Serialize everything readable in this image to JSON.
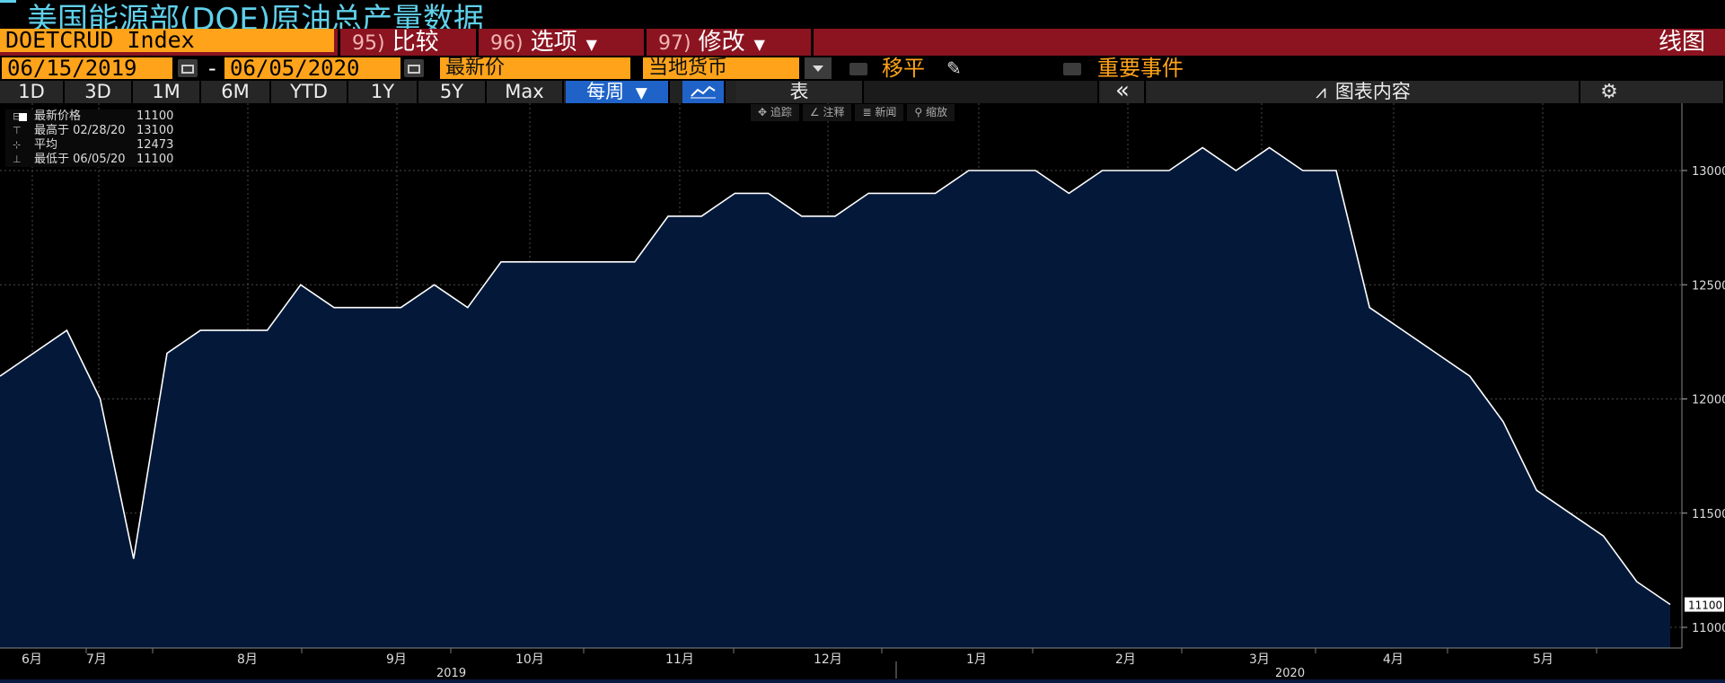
{
  "title": "美国能源部(DOE)原油总产量数据",
  "command_bar": {
    "ticker": "DOETCRUD Index",
    "compare_num": "95)",
    "compare_label": "比较",
    "options_num": "96)",
    "options_label": "选项",
    "edit_num": "97)",
    "edit_label": "修改",
    "chart_type": "线图"
  },
  "date_row": {
    "start_date": "06/15/2019",
    "dash": "-",
    "end_date": "06/05/2020",
    "price_field": "最新价",
    "currency_field": "当地货币",
    "shift_label": "移平",
    "events_label": "重要事件"
  },
  "range_bar": {
    "ranges": [
      "1D",
      "3D",
      "1M",
      "6M",
      "YTD",
      "1Y",
      "5Y",
      "Max"
    ],
    "frequency": "每周",
    "table_label": "表",
    "chart_content_label": "图表内容"
  },
  "tools": [
    "追踪",
    "注释",
    "新闻",
    "缩放"
  ],
  "legend": {
    "last_label": "最新价格",
    "last_value": "11100",
    "high_label": "最高于 02/28/20",
    "high_value": "13100",
    "avg_label": "平均",
    "avg_value": "12473",
    "low_label": "最低于 06/05/20",
    "low_value": "11100"
  },
  "colors": {
    "area_fill": "#04193a",
    "line": "#ffffff",
    "accent_orange": "#ffa31a",
    "bar_red": "#8b1420",
    "title_cyan": "#5fd0ea"
  },
  "chart_data": {
    "type": "area",
    "x": [
      "2019-06-07",
      "2019-06-14",
      "2019-06-21",
      "2019-06-28",
      "2019-07-05",
      "2019-07-12",
      "2019-07-19",
      "2019-07-26",
      "2019-08-02",
      "2019-08-09",
      "2019-08-16",
      "2019-08-23",
      "2019-08-30",
      "2019-09-06",
      "2019-09-13",
      "2019-09-20",
      "2019-09-27",
      "2019-10-04",
      "2019-10-11",
      "2019-10-18",
      "2019-10-25",
      "2019-11-01",
      "2019-11-08",
      "2019-11-15",
      "2019-11-22",
      "2019-11-29",
      "2019-12-06",
      "2019-12-13",
      "2019-12-20",
      "2019-12-27",
      "2020-01-03",
      "2020-01-10",
      "2020-01-17",
      "2020-01-24",
      "2020-01-31",
      "2020-02-07",
      "2020-02-14",
      "2020-02-21",
      "2020-02-28",
      "2020-03-06",
      "2020-03-13",
      "2020-03-20",
      "2020-03-27",
      "2020-04-03",
      "2020-04-10",
      "2020-04-17",
      "2020-04-24",
      "2020-05-01",
      "2020-05-08",
      "2020-05-15",
      "2020-05-22",
      "2020-05-29",
      "2020-06-05"
    ],
    "values": [
      12100,
      12200,
      12300,
      12000,
      11300,
      12200,
      12300,
      12300,
      12300,
      12500,
      12400,
      12400,
      12400,
      12500,
      12400,
      12600,
      12600,
      12600,
      12600,
      12600,
      12800,
      12800,
      12900,
      12900,
      12800,
      12800,
      12900,
      12900,
      12900,
      13000,
      13000,
      13000,
      12900,
      13000,
      13000,
      13000,
      13100,
      13000,
      13100,
      13000,
      13000,
      12400,
      12300,
      12200,
      12100,
      11900,
      11600,
      11500,
      11400,
      11200,
      11100
    ],
    "ylim": [
      10900,
      13200
    ],
    "yticks": [
      11000,
      11500,
      12000,
      12500,
      13000
    ],
    "ytick_labels": [
      "11000",
      "11500",
      "12000",
      "12500",
      "13000"
    ],
    "month_labels": [
      "6月",
      "7月",
      "8月",
      "9月",
      "10月",
      "11月",
      "12月",
      "1月",
      "2月",
      "3月",
      "4月",
      "5月"
    ],
    "year_labels": [
      "2019",
      "2020"
    ],
    "last_value_label": "11100",
    "grid": true
  }
}
